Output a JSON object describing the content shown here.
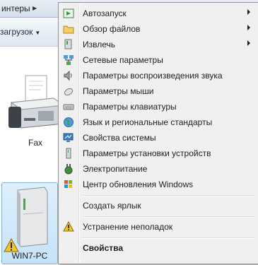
{
  "explorer": {
    "breadcrumb_label": "интеры",
    "toolbar_button_label": "загрузок"
  },
  "devices": [
    {
      "label": "Fax"
    },
    {
      "label": "WIN7-PC"
    }
  ],
  "menu": {
    "items": [
      {
        "label": "Автозапуск",
        "icon": "autoplay-icon",
        "has_submenu": true
      },
      {
        "label": "Обзор файлов",
        "icon": "folder-icon",
        "has_submenu": true
      },
      {
        "label": "Извлечь",
        "icon": "eject-icon",
        "has_submenu": true
      },
      {
        "label": "Сетевые параметры",
        "icon": "network-icon"
      },
      {
        "label": "Параметры воспроизведения звука",
        "icon": "speaker-icon"
      },
      {
        "label": "Параметры мыши",
        "icon": "mouse-icon"
      },
      {
        "label": "Параметры клавиатуры",
        "icon": "keyboard-icon"
      },
      {
        "label": "Язык и региональные стандарты",
        "icon": "globe-icon"
      },
      {
        "label": "Свойства системы",
        "icon": "system-icon"
      },
      {
        "label": "Параметры установки устройств",
        "icon": "device-icon"
      },
      {
        "label": "Электропитание",
        "icon": "power-icon"
      },
      {
        "label": "Центр обновления Windows",
        "icon": "windows-update-icon"
      },
      {
        "label": "Создать ярлык"
      },
      {
        "label": "Устранение неполадок",
        "icon": "warning-icon"
      },
      {
        "label": "Свойства",
        "bold": true
      }
    ]
  }
}
